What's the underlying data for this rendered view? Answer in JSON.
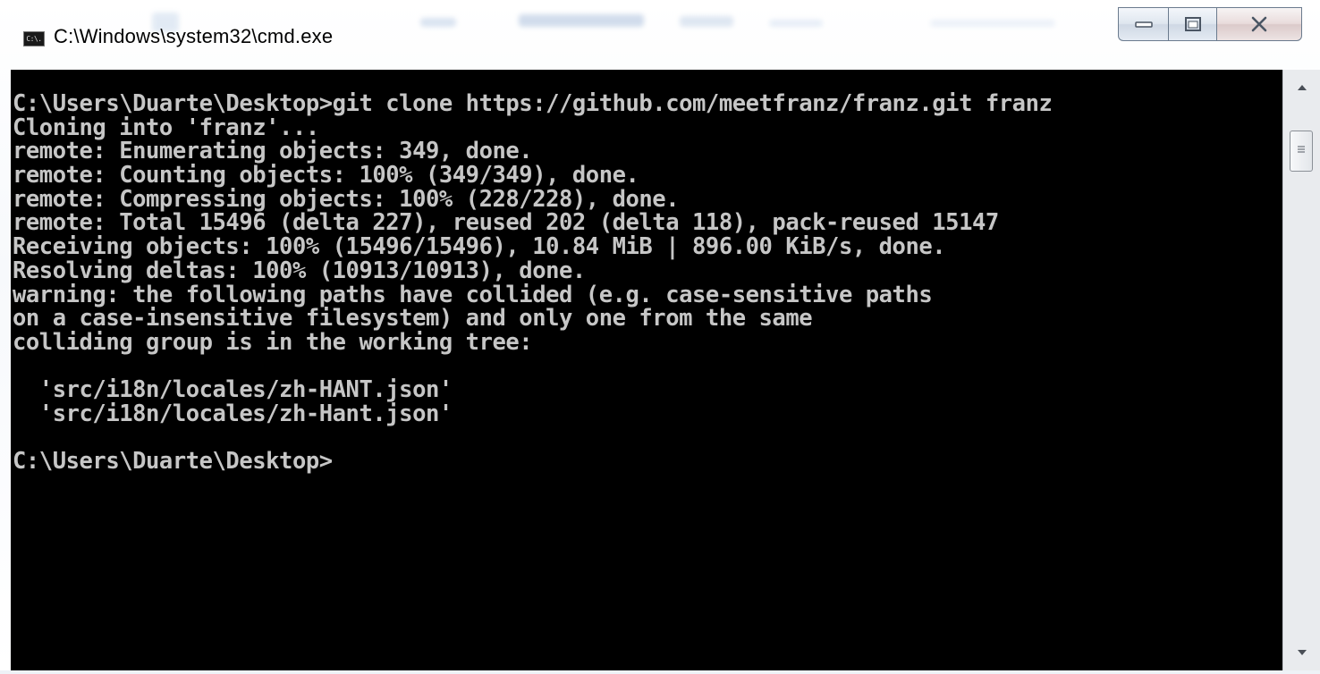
{
  "window": {
    "title": "C:\\Windows\\system32\\cmd.exe",
    "icon_name": "cmd-icon",
    "icon_text": "C:\\."
  },
  "caption_buttons": {
    "minimize_icon": "minimize-icon",
    "maximize_icon": "maximize-icon",
    "close_icon": "close-icon"
  },
  "console": {
    "background": "#000000",
    "foreground": "#c6c6c6",
    "lines": [
      "C:\\Users\\Duarte\\Desktop>git clone https://github.com/meetfranz/franz.git franz",
      "Cloning into 'franz'...",
      "remote: Enumerating objects: 349, done.",
      "remote: Counting objects: 100% (349/349), done.",
      "remote: Compressing objects: 100% (228/228), done.",
      "remote: Total 15496 (delta 227), reused 202 (delta 118), pack-reused 15147",
      "Receiving objects: 100% (15496/15496), 10.84 MiB | 896.00 KiB/s, done.",
      "Resolving deltas: 100% (10913/10913), done.",
      "warning: the following paths have collided (e.g. case-sensitive paths",
      "on a case-insensitive filesystem) and only one from the same",
      "colliding group is in the working tree:",
      "",
      "  'src/i18n/locales/zh-HANT.json'",
      "  'src/i18n/locales/zh-Hant.json'",
      "",
      "C:\\Users\\Duarte\\Desktop>"
    ]
  },
  "scrollbar": {
    "up_icon": "scroll-up-arrow-icon",
    "down_icon": "scroll-down-arrow-icon",
    "thumb_icon": "scroll-thumb-grip-icon",
    "position": 0.0
  }
}
